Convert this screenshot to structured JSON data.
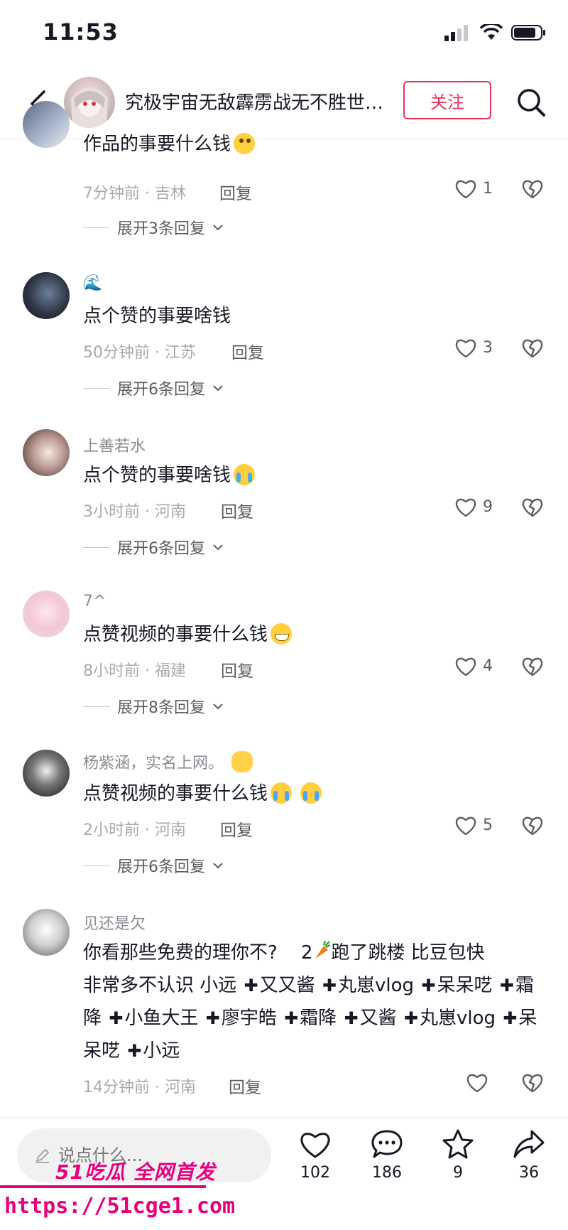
{
  "status_bar": {
    "time": "11:53"
  },
  "header": {
    "title": "究极宇宙无敌霹雳战无不胜世…",
    "follow_label": "关注"
  },
  "comments": [
    {
      "username": "",
      "content": "作品的事要什么钱",
      "time_location": "7分钟前 · 吉林",
      "reply_label": "回复",
      "likes": "1",
      "expand_label": "展开3条回复"
    },
    {
      "username": "🌊",
      "content": "点个赞的事要啥钱",
      "time_location": "50分钟前 · 江苏",
      "reply_label": "回复",
      "likes": "3",
      "expand_label": "展开6条回复"
    },
    {
      "username": "上善若水",
      "content": "点个赞的事要啥钱",
      "time_location": "3小时前 · 河南",
      "reply_label": "回复",
      "likes": "9",
      "expand_label": "展开6条回复"
    },
    {
      "username": "7^",
      "content": "点赞视频的事要什么钱",
      "time_location": "8小时前 · 福建",
      "reply_label": "回复",
      "likes": "4",
      "expand_label": "展开8条回复"
    },
    {
      "username": "杨紫涵，实名上网。",
      "content": "点赞视频的事要什么钱",
      "time_location": "2小时前 · 河南",
      "reply_label": "回复",
      "likes": "5",
      "expand_label": "展开6条回复"
    },
    {
      "username": "见还是欠",
      "content_parts": {
        "line1a": "你看那些免费的理你不?",
        "line1b": "2",
        "line1c": "跑了跳楼 比豆包快",
        "line2a": "非常多不认识  小远",
        "tags": [
          "又又酱",
          "丸崽vlog",
          "呆呆呓",
          "霜降",
          "小鱼大王",
          "廖宇皓",
          "霜降",
          "又酱",
          "丸崽vlog",
          "呆呆呓",
          "小远"
        ]
      },
      "time_location": "14分钟前 · 河南",
      "reply_label": "回复",
      "likes": ""
    }
  ],
  "bottom_bar": {
    "input_placeholder": "说点什么...",
    "likes_count": "102",
    "comments_count": "186",
    "favorites_count": "9",
    "shares_count": "36"
  },
  "watermark": {
    "logo": "51吃瓜 全网首发",
    "url": "https://51cge1.com"
  }
}
